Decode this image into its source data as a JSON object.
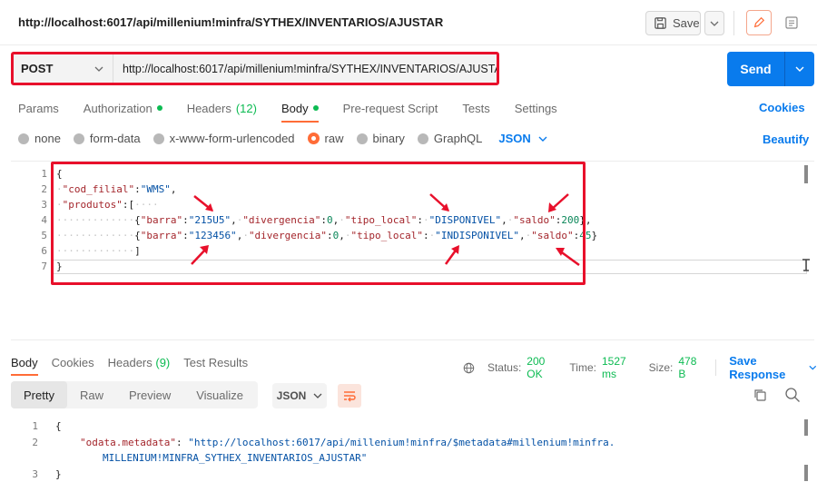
{
  "header": {
    "title": "http://localhost:6017/api/millenium!minfra/SYTHEX/INVENTARIOS/AJUSTAR",
    "save_label": "Save",
    "save_icon": "save-icon",
    "edit_icon": "pencil-icon",
    "doc_icon": "documentation-icon"
  },
  "request": {
    "method": "POST",
    "url": "http://localhost:6017/api/millenium!minfra/SYTHEX/INVENTARIOS/AJUSTAR",
    "send_label": "Send"
  },
  "request_tabs": [
    {
      "label": "Params",
      "dot": false,
      "count": ""
    },
    {
      "label": "Authorization",
      "dot": true,
      "count": ""
    },
    {
      "label": "Headers",
      "dot": false,
      "count": "(12)"
    },
    {
      "label": "Body",
      "dot": true,
      "count": ""
    },
    {
      "label": "Pre-request Script",
      "dot": false,
      "count": ""
    },
    {
      "label": "Tests",
      "dot": false,
      "count": ""
    },
    {
      "label": "Settings",
      "dot": false,
      "count": ""
    }
  ],
  "cookies_label": "Cookies",
  "body_types": {
    "none": "none",
    "form_data": "form-data",
    "urlencoded": "x-www-form-urlencoded",
    "raw": "raw",
    "binary": "binary",
    "graphql": "GraphQL",
    "format": "JSON"
  },
  "beautify_label": "Beautify",
  "request_body": {
    "line_numbers": [
      "1",
      "2",
      "3",
      "4",
      "5",
      "6",
      "7"
    ],
    "l1": "{",
    "l2_key": "\"cod_filial\"",
    "l2_val": "\"WMS\"",
    "l3_key": "\"produtos\"",
    "l4": {
      "barra_k": "\"barra\"",
      "barra_v": "\"215U5\"",
      "div_k": "\"divergencia\"",
      "div_v": "0",
      "tipo_k": "\"tipo_local\"",
      "tipo_v": "\"DISPONIVEL\"",
      "saldo_k": "\"saldo\"",
      "saldo_v": "200"
    },
    "l5": {
      "barra_k": "\"barra\"",
      "barra_v": "\"123456\"",
      "div_k": "\"divergencia\"",
      "div_v": "0",
      "tipo_k": "\"tipo_local\"",
      "tipo_v": "\"INDISPONIVEL\"",
      "saldo_k": "\"saldo\"",
      "saldo_v": "45"
    },
    "l6": "]",
    "l7": "}"
  },
  "response_tabs": {
    "body": "Body",
    "cookies": "Cookies",
    "headers": "Headers",
    "headers_count": "(9)",
    "test_results": "Test Results"
  },
  "response_meta": {
    "status_label": "Status:",
    "status": "200 OK",
    "time_label": "Time:",
    "time": "1527 ms",
    "size_label": "Size:",
    "size": "478 B",
    "save_response": "Save Response"
  },
  "response_views": {
    "pretty": "Pretty",
    "raw": "Raw",
    "preview": "Preview",
    "visualize": "Visualize",
    "format": "JSON"
  },
  "response_body": {
    "ln1": "1",
    "ln2": "2",
    "ln3": "3",
    "l1": "{",
    "l2_key": "\"odata.metadata\"",
    "l2_val_a": "\"http://localhost:6017/api/millenium!minfra/$metadata#millenium!minfra.",
    "l2_val_b": "MILLENIUM!MINFRA_SYTHEX_INVENTARIOS_AJUSTAR\"",
    "l3": "}"
  },
  "colors": {
    "accent": "#ff6c37",
    "send": "#097bed",
    "highlight": "#e8102b",
    "status_ok": "#0cbb52"
  }
}
